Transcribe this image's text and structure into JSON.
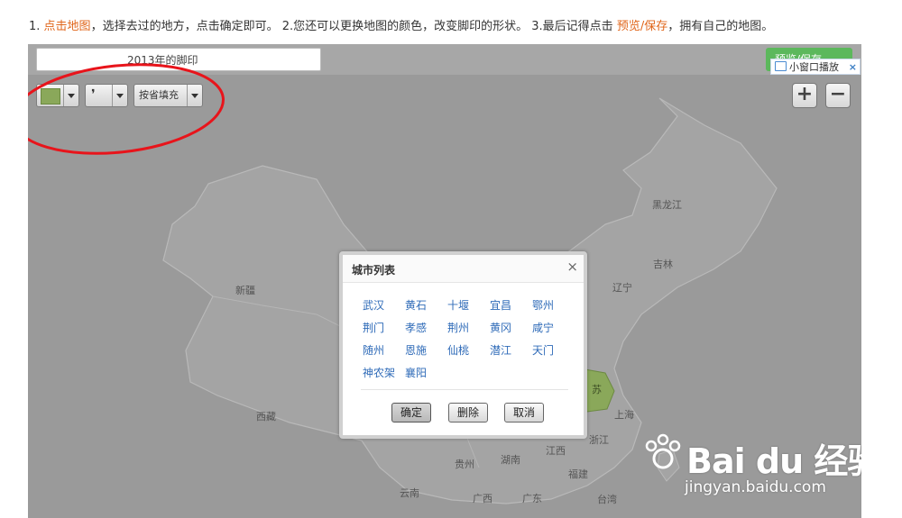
{
  "instructions": {
    "step1_num": "1.",
    "step1_link": "点击地图",
    "step1_rest": "，选择去过的地方，点击确定即可。",
    "step2": "2.您还可以更换地图的颜色，改变脚印的形状。",
    "step3_pre": "3.最后记得点击",
    "step3_link": "预览/保存",
    "step3_rest": "，拥有自己的地图。"
  },
  "toolbar": {
    "title_value": "2013年的脚印",
    "fill_mode": "按省填充",
    "preview_label": "预览/保存",
    "mini_play_label": "小窗口播放",
    "zoom_in": "+",
    "zoom_out": "−"
  },
  "provinces": [
    {
      "name": "新疆"
    },
    {
      "name": "西藏"
    },
    {
      "name": "黑龙江"
    },
    {
      "name": "吉林"
    },
    {
      "name": "辽宁"
    },
    {
      "name": "上海"
    },
    {
      "name": "浙江"
    },
    {
      "name": "江西"
    },
    {
      "name": "湖南"
    },
    {
      "name": "福建"
    },
    {
      "name": "贵州"
    },
    {
      "name": "云南"
    },
    {
      "name": "广西"
    },
    {
      "name": "广东"
    },
    {
      "name": "台湾"
    },
    {
      "name": "苏"
    }
  ],
  "dialog": {
    "title": "城市列表",
    "close": "×",
    "cities": [
      "武汉",
      "黄石",
      "十堰",
      "宜昌",
      "鄂州",
      "荆门",
      "孝感",
      "荆州",
      "黄冈",
      "咸宁",
      "随州",
      "恩施",
      "仙桃",
      "潜江",
      "天门",
      "神农架",
      "襄阳"
    ],
    "ok_label": "确定",
    "delete_label": "删除",
    "cancel_label": "取消"
  },
  "watermark": {
    "brand": "Bai du 经验",
    "url": "jingyan.baidu.com"
  },
  "colors": {
    "accent": "#e0661b",
    "link": "#2f6bb8",
    "fill_color": "#8aa85a",
    "annotation_red": "#e8141b"
  }
}
